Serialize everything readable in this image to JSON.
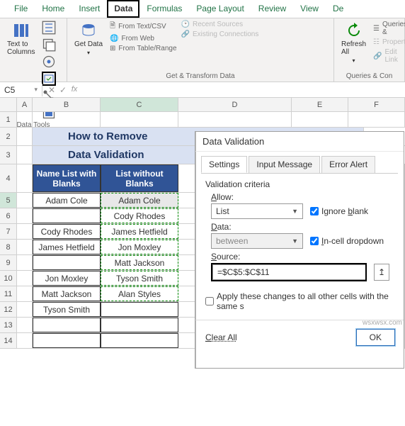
{
  "ribbon": {
    "tabs": [
      "File",
      "Home",
      "Insert",
      "Data",
      "Formulas",
      "Page Layout",
      "Review",
      "View",
      "De"
    ],
    "active_tab": "Data",
    "text_to_columns": "Text to Columns",
    "data_tools_label": "Data Tools",
    "get_data": "Get Data",
    "from_text_csv": "From Text/CSV",
    "from_web": "From Web",
    "from_table_range": "From Table/Range",
    "recent_sources": "Recent Sources",
    "existing_connections": "Existing Connections",
    "get_transform_label": "Get & Transform Data",
    "refresh_all": "Refresh All",
    "queries_a": "Queries &",
    "properties": "Propertie",
    "edit_links": "Edit Link",
    "queries_label": "Queries & Con"
  },
  "namebox": "C5",
  "sheet": {
    "cols": [
      "A",
      "B",
      "C",
      "D",
      "E",
      "F"
    ],
    "title1": "How to Remove",
    "title2": "Data Validation",
    "headers": {
      "b": "Name List with Blanks",
      "c": "List without Blanks"
    },
    "rows": [
      {
        "r": 5,
        "b": "Adam Cole",
        "c": "Adam Cole"
      },
      {
        "r": 6,
        "b": "",
        "c": "Cody Rhodes"
      },
      {
        "r": 7,
        "b": "Cody Rhodes",
        "c": "James Hetfield"
      },
      {
        "r": 8,
        "b": "James Hetfield",
        "c": "Jon Moxley"
      },
      {
        "r": 9,
        "b": "",
        "c": "Matt Jackson"
      },
      {
        "r": 10,
        "b": "Jon Moxley",
        "c": "Tyson Smith"
      },
      {
        "r": 11,
        "b": "Matt Jackson",
        "c": "Alan Styles"
      },
      {
        "r": 12,
        "b": "Tyson Smith",
        "c": ""
      },
      {
        "r": 13,
        "b": "",
        "c": ""
      },
      {
        "r": 14,
        "b": "",
        "c": ""
      }
    ]
  },
  "dialog": {
    "title": "Data Validation",
    "tabs": [
      "Settings",
      "Input Message",
      "Error Alert"
    ],
    "active_tab": "Settings",
    "criteria_label": "Validation criteria",
    "allow_label": "Allow:",
    "allow_value": "List",
    "data_label": "Data:",
    "data_value": "between",
    "source_label": "Source:",
    "source_value": "=$C$5:$C$11",
    "ignore_blank": "Ignore blank",
    "ignore_blank_checked": true,
    "incell_dropdown": "In-cell dropdown",
    "incell_dropdown_checked": true,
    "apply_changes": "Apply these changes to all other cells with the same s",
    "apply_changes_checked": false,
    "clear_all": "Clear All",
    "ok": "OK"
  },
  "watermark": "wsxwsx.com",
  "chart_data": null
}
